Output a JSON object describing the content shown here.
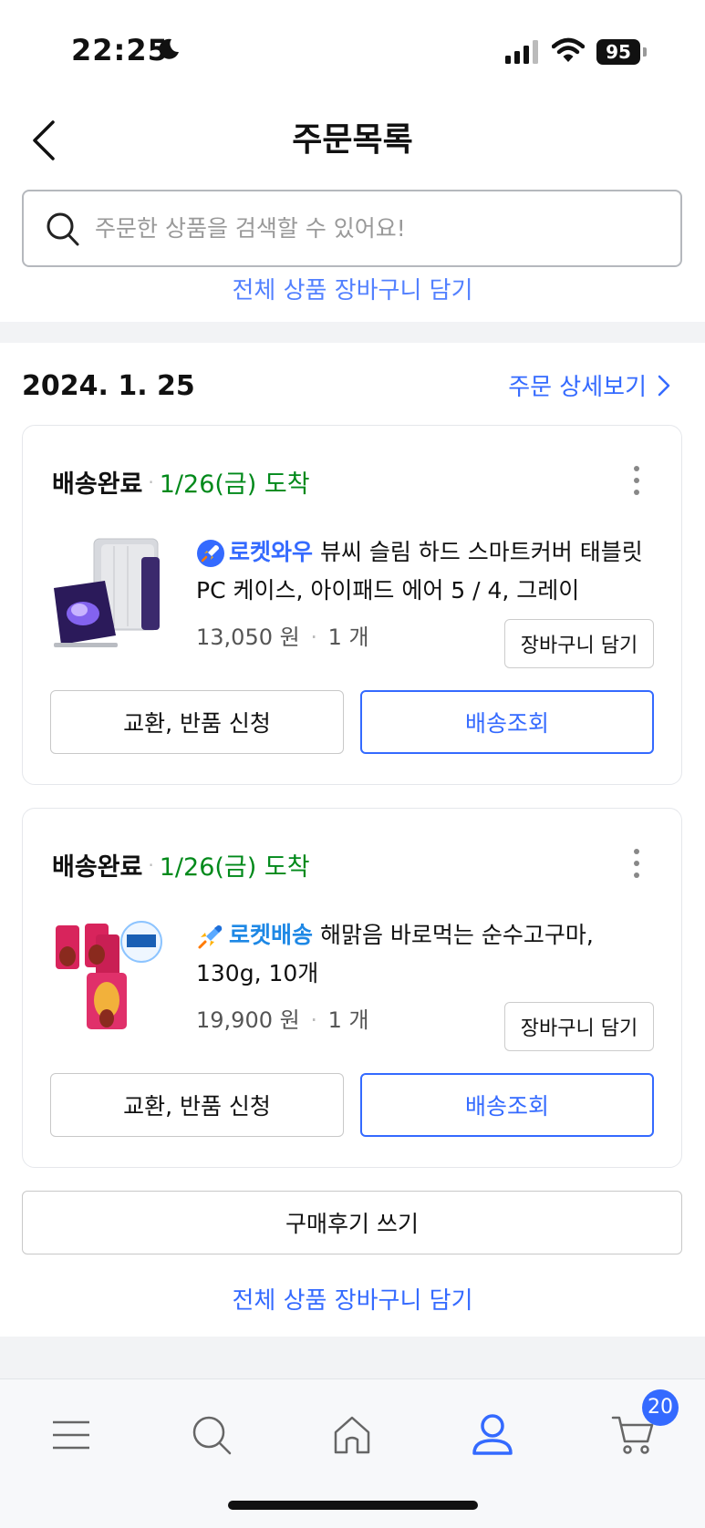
{
  "status_bar": {
    "time": "22:25",
    "battery": "95"
  },
  "header": {
    "title": "주문목록"
  },
  "search": {
    "placeholder": "주문한 상품을 검색할 수 있어요!"
  },
  "peek_link": "전체 상품 장바구니 담기",
  "order": {
    "date": "2024. 1. 25",
    "detail_link": "주문 상세보기",
    "items": [
      {
        "status": "배송완료",
        "arrival": "1/26(금) 도착",
        "badge": "로켓와우",
        "name": "뷰씨 슬림 하드 스마트커버 태블릿 PC 케이스, 아이패드 에어 5 / 4, 그레이",
        "price": "13,050 원",
        "qty": "1 개",
        "cart_label": "장바구니 담기",
        "return_label": "교환, 반품 신청",
        "track_label": "배송조회"
      },
      {
        "status": "배송완료",
        "arrival": "1/26(금) 도착",
        "badge": "로켓배송",
        "name": "해맑음 바로먹는 순수고구마, 130g, 10개",
        "price": "19,900 원",
        "qty": "1 개",
        "cart_label": "장바구니 담기",
        "return_label": "교환, 반품 신청",
        "track_label": "배송조회"
      }
    ],
    "review_label": "구매후기 쓰기",
    "add_all_label": "전체 상품 장바구니 담기"
  },
  "bottom_nav": {
    "items": [
      "menu-icon",
      "search-icon",
      "home-icon",
      "my-page-icon",
      "cart-icon"
    ],
    "active": "my-page-icon",
    "cart_count": "20"
  },
  "colors": {
    "accent": "#346aff",
    "arrival_green": "#00891a"
  }
}
